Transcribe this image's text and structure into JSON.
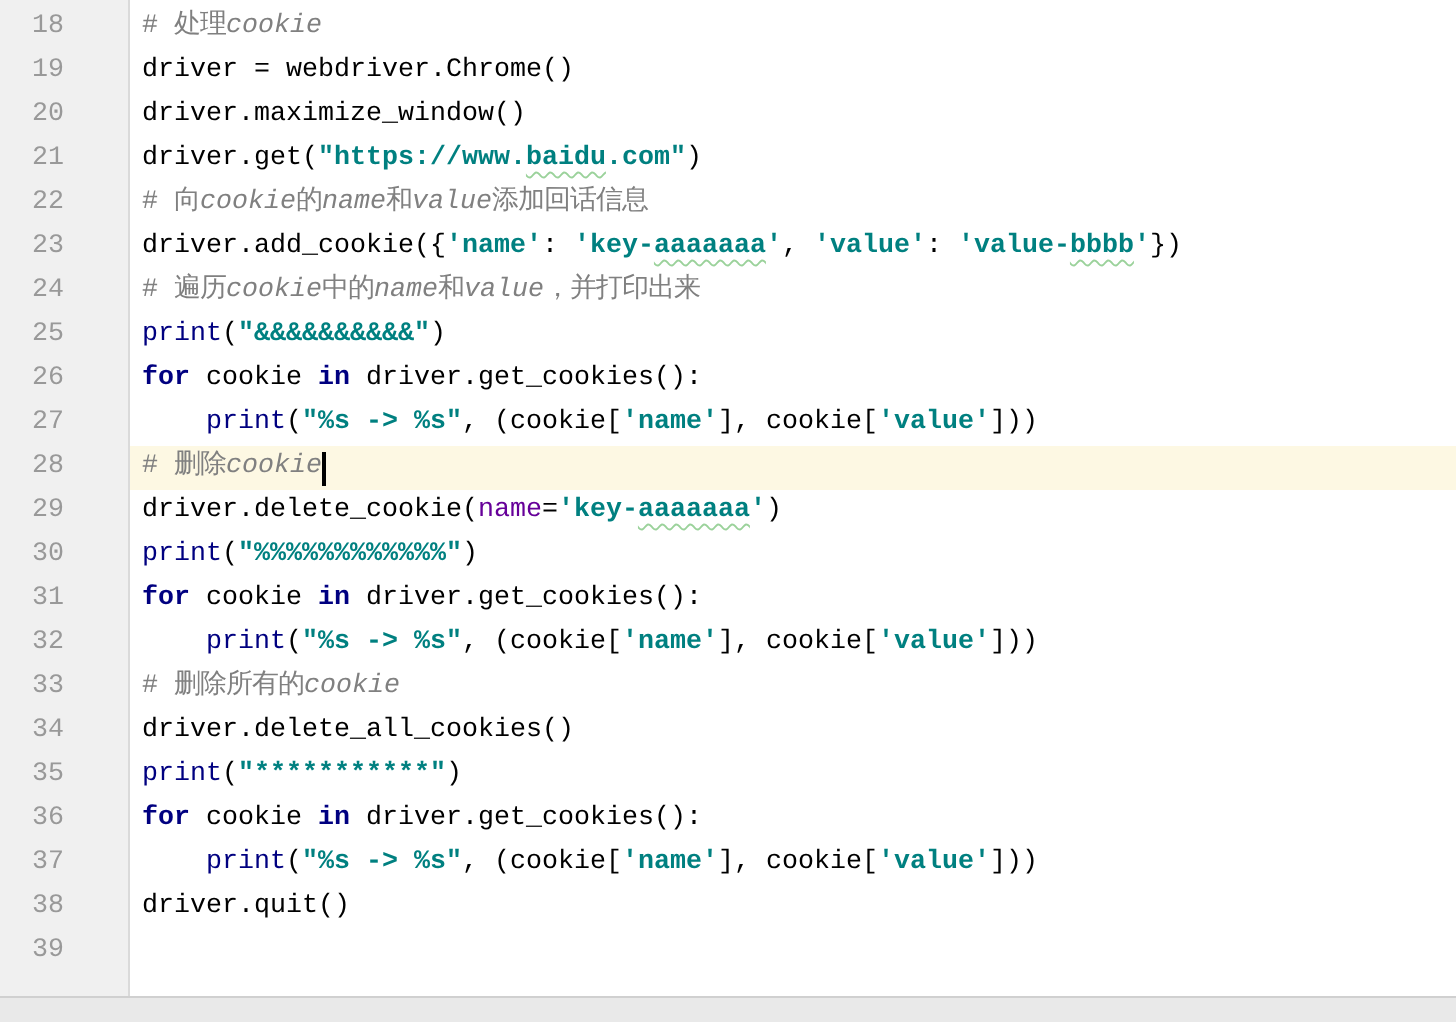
{
  "editor": {
    "lines": [
      {
        "number": "18",
        "current": false,
        "segments": [
          {
            "kind": "comment",
            "text": "# 处理"
          },
          {
            "kind": "comment",
            "italic": true,
            "text": "cookie"
          }
        ]
      },
      {
        "number": "19",
        "current": false,
        "segments": [
          {
            "kind": "plain",
            "text": "driver = webdriver.Chrome()"
          }
        ]
      },
      {
        "number": "20",
        "current": false,
        "segments": [
          {
            "kind": "plain",
            "text": "driver.maximize_window()"
          }
        ]
      },
      {
        "number": "21",
        "current": false,
        "segments": [
          {
            "kind": "plain",
            "text": "driver.get("
          },
          {
            "kind": "string",
            "text": "\"https://www."
          },
          {
            "kind": "string",
            "typo": true,
            "text": "baidu"
          },
          {
            "kind": "string",
            "text": ".com\""
          },
          {
            "kind": "plain",
            "text": ")"
          }
        ]
      },
      {
        "number": "22",
        "current": false,
        "segments": [
          {
            "kind": "comment",
            "text": "# 向"
          },
          {
            "kind": "comment",
            "italic": true,
            "text": "cookie"
          },
          {
            "kind": "comment",
            "text": "的"
          },
          {
            "kind": "comment",
            "italic": true,
            "text": "name"
          },
          {
            "kind": "comment",
            "text": "和"
          },
          {
            "kind": "comment",
            "italic": true,
            "text": "value"
          },
          {
            "kind": "comment",
            "text": "添加回话信息"
          }
        ]
      },
      {
        "number": "23",
        "current": false,
        "segments": [
          {
            "kind": "plain",
            "text": "driver.add_cookie({"
          },
          {
            "kind": "string",
            "text": "'name'"
          },
          {
            "kind": "plain",
            "text": ": "
          },
          {
            "kind": "string",
            "text": "'key-"
          },
          {
            "kind": "string",
            "typo": true,
            "text": "aaaaaaa"
          },
          {
            "kind": "string",
            "text": "'"
          },
          {
            "kind": "plain",
            "text": ", "
          },
          {
            "kind": "string",
            "text": "'value'"
          },
          {
            "kind": "plain",
            "text": ": "
          },
          {
            "kind": "string",
            "text": "'value-"
          },
          {
            "kind": "string",
            "typo": true,
            "text": "bbbb"
          },
          {
            "kind": "string",
            "text": "'"
          },
          {
            "kind": "plain",
            "text": "})"
          }
        ]
      },
      {
        "number": "24",
        "current": false,
        "segments": [
          {
            "kind": "comment",
            "text": "# 遍历"
          },
          {
            "kind": "comment",
            "italic": true,
            "text": "cookie"
          },
          {
            "kind": "comment",
            "text": "中的"
          },
          {
            "kind": "comment",
            "italic": true,
            "text": "name"
          },
          {
            "kind": "comment",
            "text": "和"
          },
          {
            "kind": "comment",
            "italic": true,
            "text": "value"
          },
          {
            "kind": "comment",
            "text": "，并打印出来"
          }
        ]
      },
      {
        "number": "25",
        "current": false,
        "segments": [
          {
            "kind": "builtin",
            "text": "print"
          },
          {
            "kind": "plain",
            "text": "("
          },
          {
            "kind": "string",
            "text": "\"&&&&&&&&&&\""
          },
          {
            "kind": "plain",
            "text": ")"
          }
        ]
      },
      {
        "number": "26",
        "current": false,
        "segments": [
          {
            "kind": "keyword",
            "text": "for"
          },
          {
            "kind": "plain",
            "text": " cookie "
          },
          {
            "kind": "keyword",
            "text": "in"
          },
          {
            "kind": "plain",
            "text": " driver.get_cookies():"
          }
        ]
      },
      {
        "number": "27",
        "current": false,
        "indented": true,
        "segments": [
          {
            "kind": "builtin",
            "text": "print"
          },
          {
            "kind": "plain",
            "text": "("
          },
          {
            "kind": "string",
            "text": "\"%s -> %s\""
          },
          {
            "kind": "plain",
            "text": ", (cookie["
          },
          {
            "kind": "string",
            "text": "'name'"
          },
          {
            "kind": "plain",
            "text": "], cookie["
          },
          {
            "kind": "string",
            "text": "'value'"
          },
          {
            "kind": "plain",
            "text": "]))"
          }
        ]
      },
      {
        "number": "28",
        "current": true,
        "segments": [
          {
            "kind": "comment",
            "text": "# 删除"
          },
          {
            "kind": "comment",
            "italic": true,
            "text": "cookie"
          }
        ]
      },
      {
        "number": "29",
        "current": false,
        "segments": [
          {
            "kind": "plain",
            "text": "driver.delete_cookie("
          },
          {
            "kind": "param",
            "text": "name"
          },
          {
            "kind": "plain",
            "text": "="
          },
          {
            "kind": "string",
            "text": "'key-"
          },
          {
            "kind": "string",
            "typo": true,
            "text": "aaaaaaa"
          },
          {
            "kind": "string",
            "text": "'"
          },
          {
            "kind": "plain",
            "text": ")"
          }
        ]
      },
      {
        "number": "30",
        "current": false,
        "segments": [
          {
            "kind": "builtin",
            "text": "print"
          },
          {
            "kind": "plain",
            "text": "("
          },
          {
            "kind": "string",
            "text": "\"%%%%%%%%%%%%\""
          },
          {
            "kind": "plain",
            "text": ")"
          }
        ]
      },
      {
        "number": "31",
        "current": false,
        "segments": [
          {
            "kind": "keyword",
            "text": "for"
          },
          {
            "kind": "plain",
            "text": " cookie "
          },
          {
            "kind": "keyword",
            "text": "in"
          },
          {
            "kind": "plain",
            "text": " driver.get_cookies():"
          }
        ]
      },
      {
        "number": "32",
        "current": false,
        "indented": true,
        "segments": [
          {
            "kind": "builtin",
            "text": "print"
          },
          {
            "kind": "plain",
            "text": "("
          },
          {
            "kind": "string",
            "text": "\"%s -> %s\""
          },
          {
            "kind": "plain",
            "text": ", (cookie["
          },
          {
            "kind": "string",
            "text": "'name'"
          },
          {
            "kind": "plain",
            "text": "], cookie["
          },
          {
            "kind": "string",
            "text": "'value'"
          },
          {
            "kind": "plain",
            "text": "]))"
          }
        ]
      },
      {
        "number": "33",
        "current": false,
        "segments": [
          {
            "kind": "comment",
            "text": "# 删除所有的"
          },
          {
            "kind": "comment",
            "italic": true,
            "text": "cookie"
          }
        ]
      },
      {
        "number": "34",
        "current": false,
        "segments": [
          {
            "kind": "plain",
            "text": "driver.delete_all_cookies()"
          }
        ]
      },
      {
        "number": "35",
        "current": false,
        "segments": [
          {
            "kind": "builtin",
            "text": "print"
          },
          {
            "kind": "plain",
            "text": "("
          },
          {
            "kind": "string",
            "text": "\"***********\""
          },
          {
            "kind": "plain",
            "text": ")"
          }
        ]
      },
      {
        "number": "36",
        "current": false,
        "segments": [
          {
            "kind": "keyword",
            "text": "for"
          },
          {
            "kind": "plain",
            "text": " cookie "
          },
          {
            "kind": "keyword",
            "text": "in"
          },
          {
            "kind": "plain",
            "text": " driver.get_cookies():"
          }
        ]
      },
      {
        "number": "37",
        "current": false,
        "indented": true,
        "segments": [
          {
            "kind": "builtin",
            "text": "print"
          },
          {
            "kind": "plain",
            "text": "("
          },
          {
            "kind": "string",
            "text": "\"%s -> %s\""
          },
          {
            "kind": "plain",
            "text": ", (cookie["
          },
          {
            "kind": "string",
            "text": "'name'"
          },
          {
            "kind": "plain",
            "text": "], cookie["
          },
          {
            "kind": "string",
            "text": "'value'"
          },
          {
            "kind": "plain",
            "text": "]))"
          }
        ]
      },
      {
        "number": "38",
        "current": false,
        "segments": [
          {
            "kind": "plain",
            "text": "driver.quit()"
          }
        ]
      },
      {
        "number": "39",
        "current": false
      }
    ]
  }
}
